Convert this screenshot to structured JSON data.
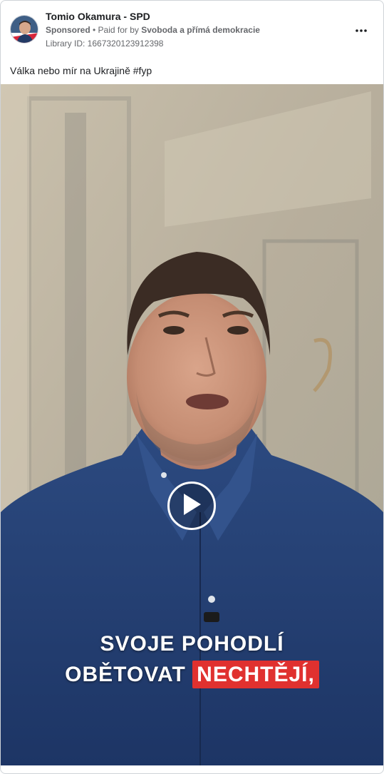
{
  "post": {
    "page_name": "Tomio Okamura - SPD",
    "sponsored_label": "Sponsored",
    "separator": " • ",
    "paid_for_prefix": "Paid for by ",
    "paid_for_by": "Svoboda a přímá demokracie",
    "library_id": "Library ID: 1667320123912398",
    "caption": "Válka nebo mír na Ukrajině #fyp",
    "more_icon": "more-horizontal-icon",
    "play_icon": "play-icon"
  },
  "video": {
    "subtitle_line_1": "SVOJE POHODLÍ",
    "subtitle_line_2_plain": "OBĚTOVAT ",
    "subtitle_line_2_highlight": "NECHTĚJÍ,",
    "highlight_color": "#e0312f"
  }
}
